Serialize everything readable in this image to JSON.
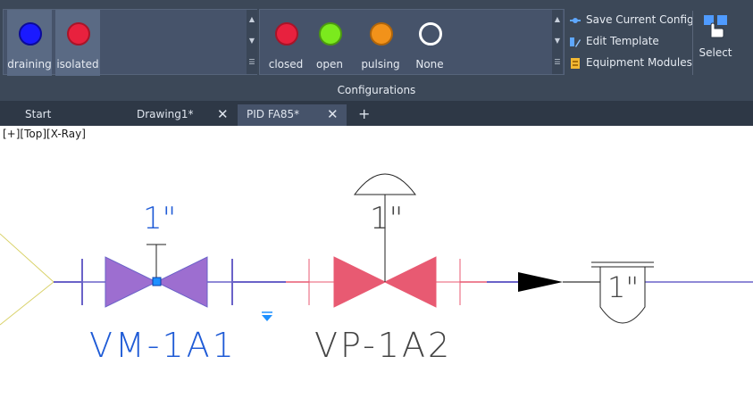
{
  "ribbon": {
    "valve_states": [
      {
        "label": "draining",
        "color": "#1a1aff",
        "selected": true
      },
      {
        "label": "isolated",
        "color": "#e8213e",
        "selected": true
      }
    ],
    "line_states": [
      {
        "label": "closed",
        "color": "#e8213e"
      },
      {
        "label": "open",
        "color": "#7bea1d"
      },
      {
        "label": "pulsing",
        "color": "#f2921a"
      },
      {
        "label": "None",
        "color": "#ffffff"
      }
    ],
    "commands": [
      {
        "label": "Save Current Config",
        "icon": "save-config-icon"
      },
      {
        "label": "Edit Template",
        "icon": "edit-template-icon"
      },
      {
        "label": "Equipment Modules",
        "icon": "equipment-modules-icon"
      }
    ],
    "select_label": "Select",
    "panel_title": "Configurations"
  },
  "tabs": [
    {
      "label": "Start",
      "active": false
    },
    {
      "label": "Drawing1*",
      "active": false
    },
    {
      "label": "PID FA85*",
      "active": true
    }
  ],
  "view_label": "[+][Top][X-Ray]",
  "drawing": {
    "valve1_size": "1\"",
    "valve1_tag": "VM-1A1",
    "valve2_size": "1\"",
    "valve2_tag": "VP-1A2",
    "instrument_size": "1\""
  },
  "colors": {
    "ribbon_bg": "#3c4858",
    "valve1_fill": "#9d6ed0",
    "valve1_tag": "#1f5bd6",
    "valve2_fill": "#e85a72",
    "line_purple": "#6a62c8"
  }
}
